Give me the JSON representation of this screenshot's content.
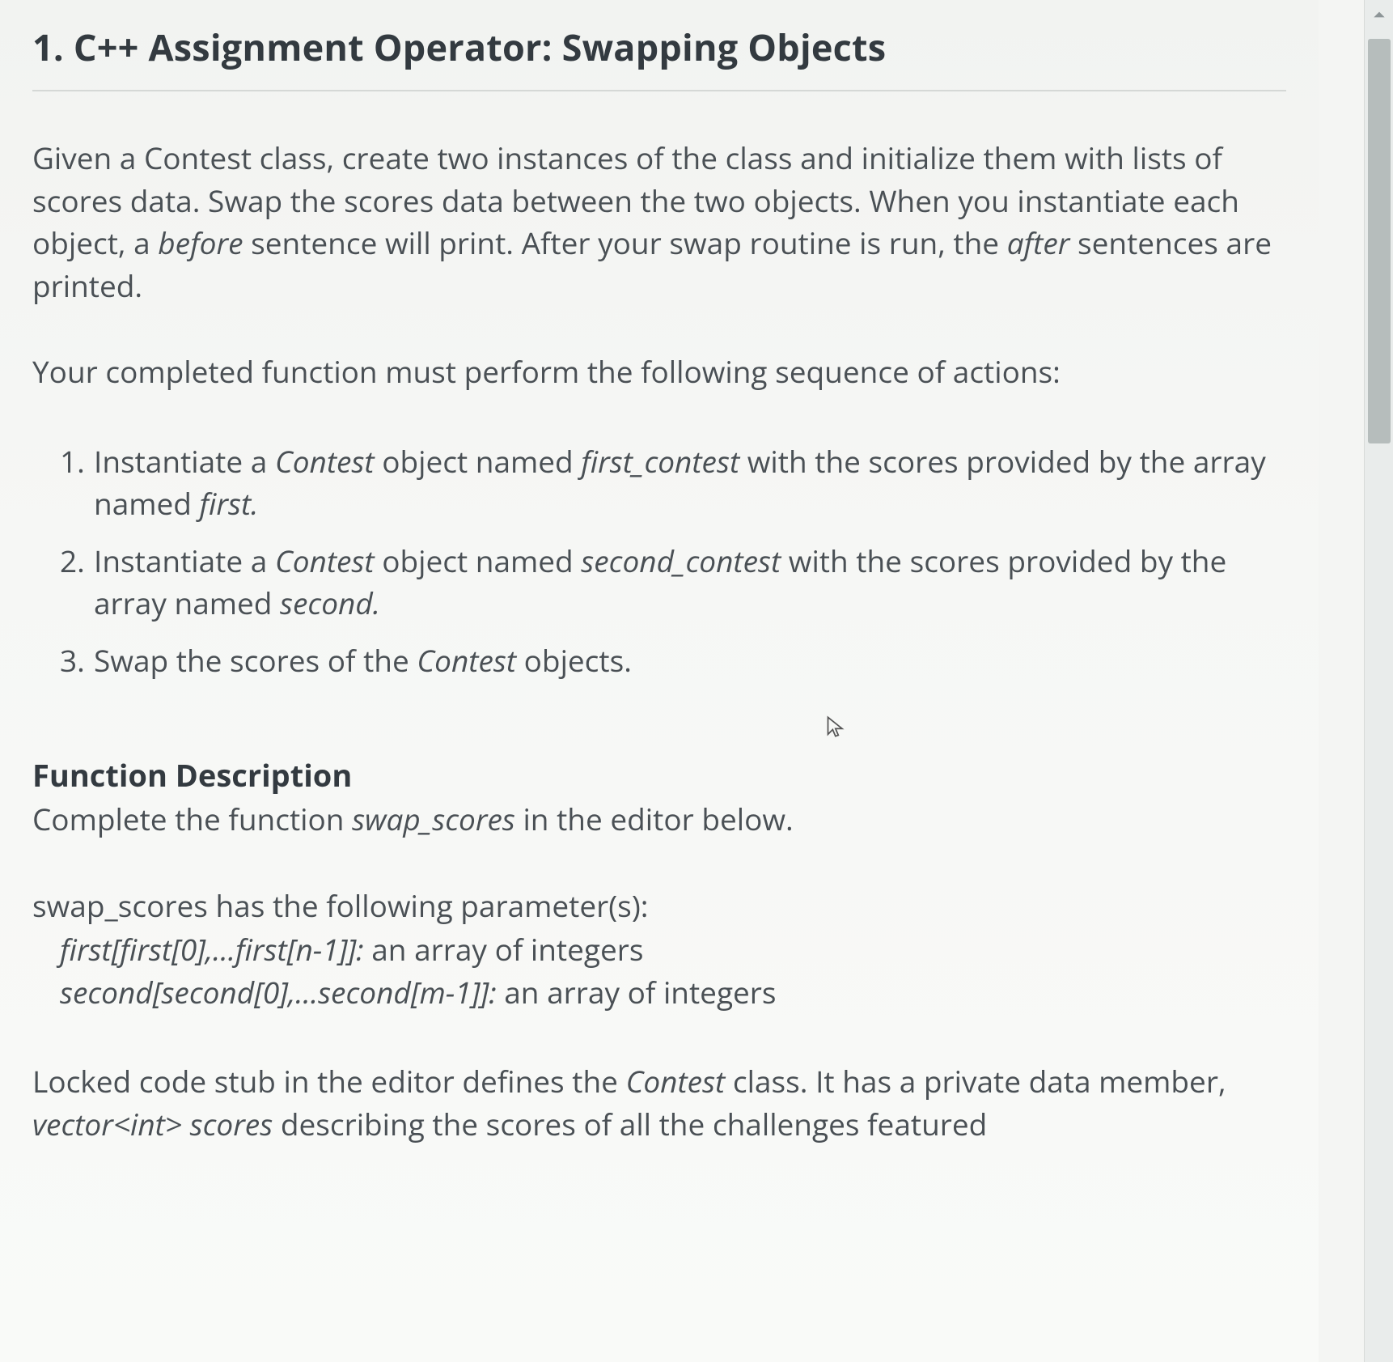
{
  "title": "1. C++ Assignment Operator: Swapping Objects",
  "intro": {
    "pre1": "Given a Contest class, create two instances of the class and initialize them with lists of scores data. Swap the scores data between the two objects. When you instantiate each object, a ",
    "em1": "before",
    "mid1": " sentence will print. After your swap routine is run, the ",
    "em2": "after",
    "post1": " sentences are printed."
  },
  "seq_intro": "Your completed function must perform the following sequence of actions:",
  "steps": [
    {
      "num": "1.",
      "t0": "Instantiate a ",
      "e0": "Contest",
      "t1": " object named ",
      "e1": "first_contest",
      "t2": " with the scores provided by the array named ",
      "e2": "first.",
      "t3": ""
    },
    {
      "num": "2.",
      "t0": "Instantiate a ",
      "e0": "Contest",
      "t1": " object named ",
      "e1": "second_contest",
      "t2": " with the scores provided by the array named ",
      "e2": "second.",
      "t3": ""
    },
    {
      "num": "3.",
      "t0": "Swap the scores of the ",
      "e0": "Contest",
      "t1": " objects.",
      "e1": "",
      "t2": "",
      "e2": "",
      "t3": ""
    }
  ],
  "fd_head": "Function Description",
  "fd_body": {
    "t0": "Complete the function ",
    "e0": "swap_scores",
    "t1": " in the editor below."
  },
  "params_intro": "swap_scores has the following parameter(s):",
  "params": [
    {
      "sig": "first[first[0],...first[n-1]]:",
      "desc": "  an array of integers"
    },
    {
      "sig": "second[second[0],...second[m-1]]:",
      "desc": "  an array of integers"
    }
  ],
  "locked": {
    "t0": "Locked code stub in the editor defines the ",
    "e0": "Contest",
    "t1": " class. It has a private data member, ",
    "e1": "vector<int> scores",
    "t2": " describing the scores of all the challenges featured"
  }
}
